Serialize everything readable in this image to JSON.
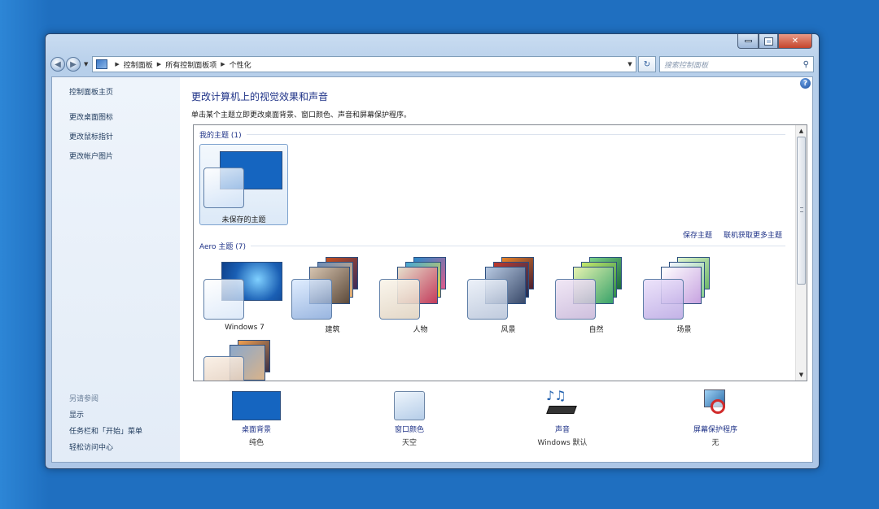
{
  "window": {
    "breadcrumb": [
      "控制面板",
      "所有控制面板项",
      "个性化"
    ],
    "search_placeholder": "搜索控制面板"
  },
  "sidebar": {
    "home": "控制面板主页",
    "links": [
      "更改桌面图标",
      "更改鼠标指针",
      "更改帐户图片"
    ],
    "see_also_header": "另请参阅",
    "see_also": [
      "显示",
      "任务栏和「开始」菜单",
      "轻松访问中心"
    ]
  },
  "main": {
    "title": "更改计算机上的视觉效果和声音",
    "subtitle": "单击某个主题立即更改桌面背景、窗口颜色、声音和屏幕保护程序。",
    "my_themes_header": "我的主题 (1)",
    "unsaved_theme": "未保存的主题",
    "save_theme": "保存主题",
    "get_more_themes": "联机获取更多主题",
    "aero_header": "Aero 主题 (7)",
    "aero_themes": [
      "Windows 7",
      "建筑",
      "人物",
      "风景",
      "自然",
      "场景"
    ]
  },
  "tray": {
    "items": [
      {
        "label": "桌面背景",
        "value": "纯色",
        "icon": "desktop-background-icon"
      },
      {
        "label": "窗口颜色",
        "value": "天空",
        "icon": "window-color-icon"
      },
      {
        "label": "声音",
        "value": "Windows 默认",
        "icon": "sound-icon"
      },
      {
        "label": "屏幕保护程序",
        "value": "无",
        "icon": "screensaver-icon"
      }
    ]
  },
  "colors": {
    "desktop": "#1f6fc0",
    "link": "#1e3287",
    "solid_background": "#1565c0"
  }
}
